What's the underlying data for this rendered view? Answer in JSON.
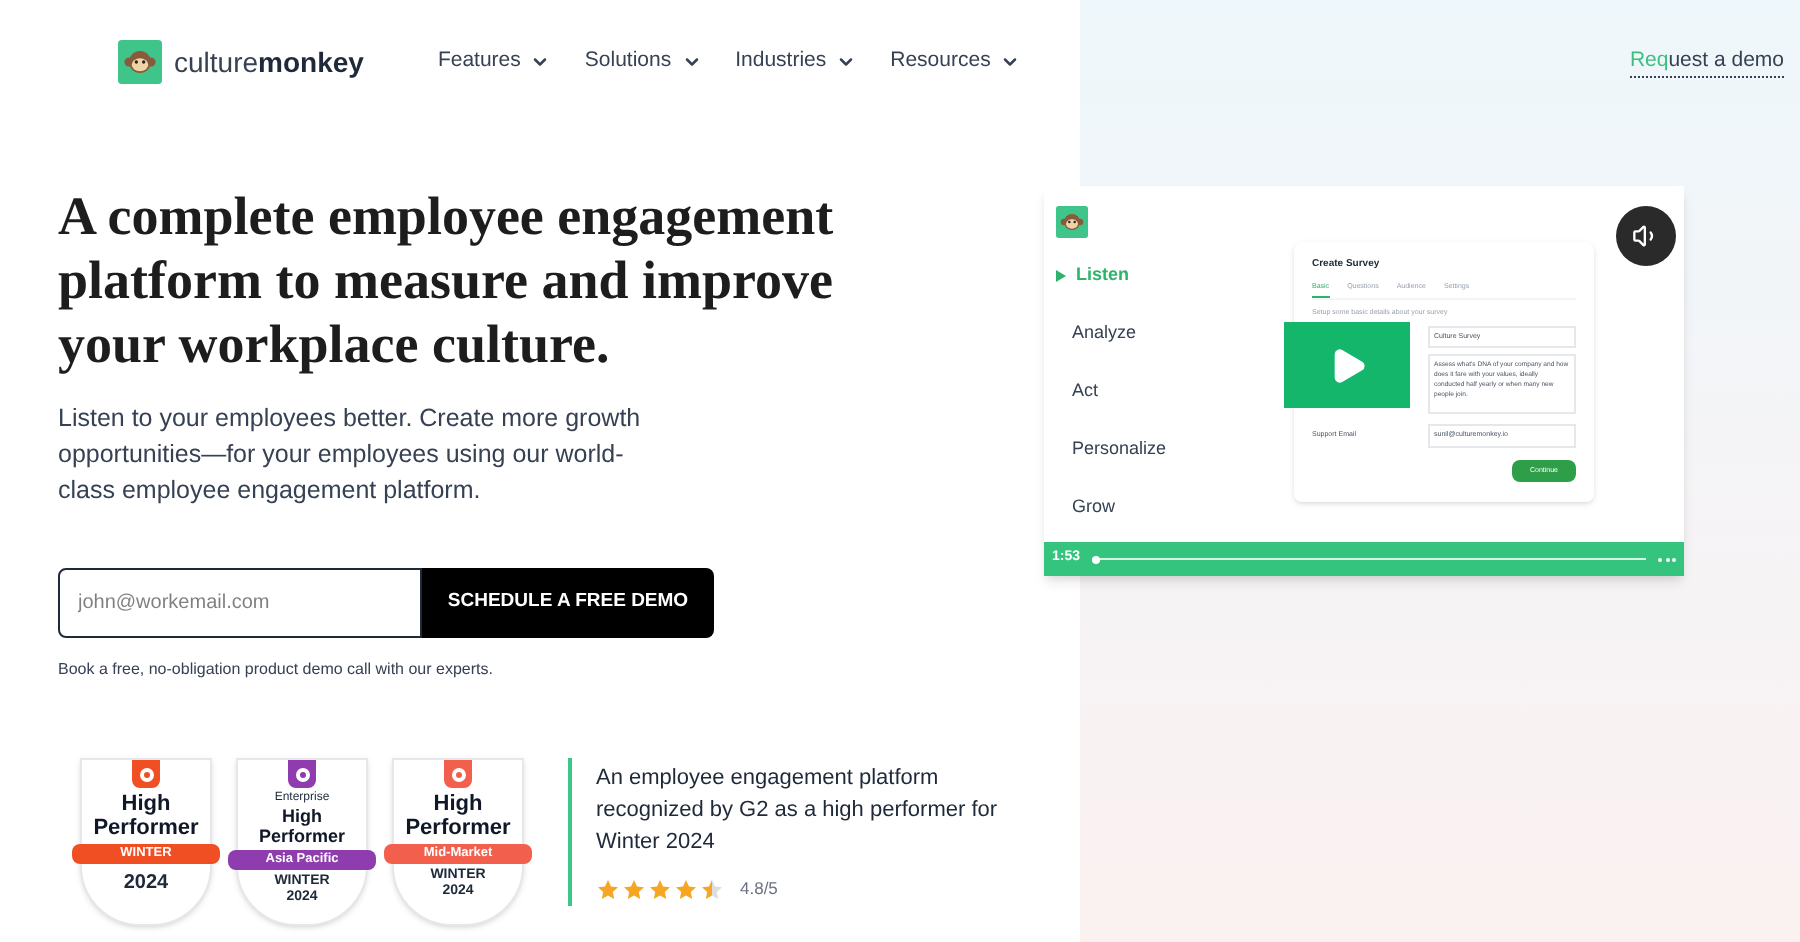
{
  "header": {
    "logo": {
      "light": "culture",
      "bold": "monkey"
    },
    "nav": [
      {
        "label": "Features"
      },
      {
        "label": "Solutions"
      },
      {
        "label": "Industries"
      },
      {
        "label": "Resources"
      }
    ],
    "cta": {
      "accent": "Req",
      "rest": "uest a demo"
    }
  },
  "hero": {
    "title": "A complete employee engagement platform to measure and improve your workplace culture.",
    "subtitle": "Listen to your employees better. Create more growth opportunities—for your employees using our world-class employee engagement platform.",
    "email_placeholder": "john@workemail.com",
    "button": "SCHEDULE A FREE DEMO",
    "note": "Book a free, no-obligation product demo call with our experts."
  },
  "badges": [
    {
      "title": "High Performer",
      "ribbon": "WINTER",
      "color": "#f04e23",
      "year": "2024"
    },
    {
      "top": "Enterprise",
      "title": "High Performer",
      "ribbon": "Asia Pacific",
      "color": "#8e3cae",
      "year": "WINTER 2024"
    },
    {
      "title": "High Performer",
      "ribbon": "Mid-Market",
      "color": "#f25f4c",
      "year": "WINTER 2024"
    }
  ],
  "recognition": {
    "text": "An employee engagement platform recognized by G2 as a high performer for Winter 2024",
    "stars": 4.5,
    "rating": "4.8/5"
  },
  "video": {
    "menu": [
      {
        "label": "Listen",
        "selected": true
      },
      {
        "label": "Analyze",
        "selected": false
      },
      {
        "label": "Act",
        "selected": false
      },
      {
        "label": "Personalize",
        "selected": false
      },
      {
        "label": "Grow",
        "selected": false
      }
    ],
    "form": {
      "title": "Create Survey",
      "tabs": [
        {
          "label": "Basic",
          "selected": true
        },
        {
          "label": "Questions",
          "selected": false
        },
        {
          "label": "Audience",
          "selected": false
        },
        {
          "label": "Settings",
          "selected": false
        }
      ],
      "hint": "Setup some basic details about your survey",
      "name_value": "Culture Survey",
      "description": "Assess what's DNA of your company and how does it fare with your values, ideally conducted half yearly or when many new people join.",
      "email_label": "Support Email",
      "email_value": "sunil@culturemonkey.io",
      "button": "Continue"
    },
    "time": "1:53",
    "level": 0.01
  }
}
